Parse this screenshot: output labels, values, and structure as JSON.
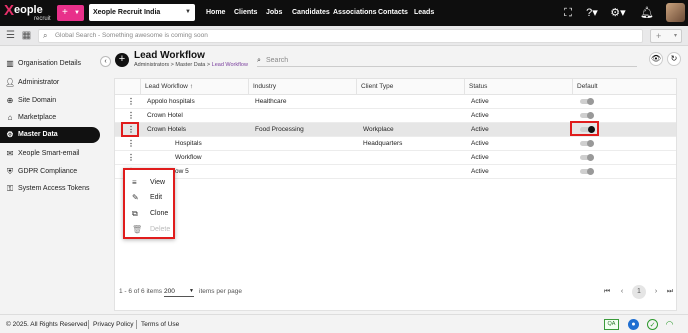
{
  "topbar": {
    "logo_mark": "X",
    "logo_word": "eople",
    "logo_sub": "recruit",
    "plus_label": "+",
    "tenant": "Xeople Recruit India",
    "nav": [
      "Home",
      "Clients",
      "Jobs",
      "Candidates",
      "Associations",
      "Contacts",
      "Leads"
    ]
  },
  "subbar": {
    "search_placeholder": "Global Search - Something awesome is coming soon",
    "plus_label": "+"
  },
  "sidebar": {
    "items": [
      {
        "label": "Organisation Details",
        "icon": "building-icon"
      },
      {
        "label": "Administrator",
        "icon": "person-icon"
      },
      {
        "label": "Site Domain",
        "icon": "globe-icon"
      },
      {
        "label": "Marketplace",
        "icon": "store-icon"
      },
      {
        "label": "Master Data",
        "icon": "gear-icon",
        "active": true
      },
      {
        "label": "Xeople Smart-email",
        "icon": "email-icon"
      },
      {
        "label": "GDPR Compliance",
        "icon": "shield-icon"
      },
      {
        "label": "System Access Tokens",
        "icon": "key-icon"
      }
    ]
  },
  "page": {
    "title": "Lead Workflow",
    "breadcrumb": {
      "parts": "Administrators > Master Data > ",
      "current": "Lead Workflow"
    },
    "search_placeholder": "Search"
  },
  "table": {
    "columns": [
      "Lead Workflow",
      "Industry",
      "Client Type",
      "Status",
      "Default"
    ],
    "sort_indicator": "↑",
    "rows": [
      {
        "name": "Appolo hospitals",
        "industry": "Healthcare",
        "client_type": "",
        "status": "Active",
        "default": false
      },
      {
        "name": "Crown Hotel",
        "industry": "",
        "client_type": "",
        "status": "Active",
        "default": false
      },
      {
        "name": "Crown Hotels",
        "industry": "Food Processing",
        "client_type": "Workplace",
        "status": "Active",
        "default": true
      },
      {
        "name": "Hospitals",
        "industry": "",
        "client_type": "Headquarters",
        "status": "Active",
        "default": false
      },
      {
        "name": "Workflow",
        "industry": "",
        "client_type": "",
        "status": "Active",
        "default": false
      },
      {
        "name": "ow 5",
        "industry": "",
        "client_type": "",
        "status": "Active",
        "default": false
      }
    ]
  },
  "row_menu": {
    "items": [
      {
        "label": "View",
        "icon": "list-icon",
        "enabled": true
      },
      {
        "label": "Edit",
        "icon": "pencil-icon",
        "enabled": true
      },
      {
        "label": "Clone",
        "icon": "copy-icon",
        "enabled": true
      },
      {
        "label": "Delete",
        "icon": "trash-icon",
        "enabled": false
      }
    ]
  },
  "pagination": {
    "range_text": "1 - 6 of 6 items",
    "per_page_value": "200",
    "per_page_label": "items per page",
    "current_page": "1",
    "first": "⏮",
    "prev": "‹",
    "next": "›",
    "last": "⏭"
  },
  "footer": {
    "copyright": "© 2025. All Rights Reserved",
    "privacy": "Privacy Policy",
    "terms": "Terms of Use",
    "qa_badge": "QA"
  }
}
